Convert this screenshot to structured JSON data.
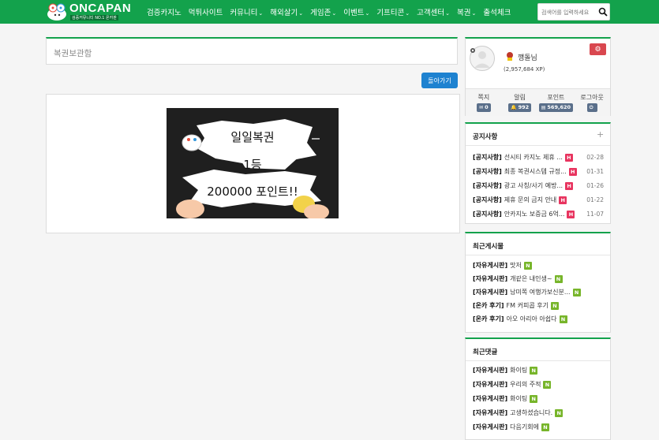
{
  "header": {
    "logo_text": "ONCAPAN",
    "logo_sub": "검증커뮤니티 NO.1 온카판",
    "nav": [
      {
        "label": "검증카지노",
        "dropdown": false
      },
      {
        "label": "먹튀사이트",
        "dropdown": false
      },
      {
        "label": "커뮤니티",
        "dropdown": true
      },
      {
        "label": "해외살기",
        "dropdown": true
      },
      {
        "label": "게임존",
        "dropdown": true
      },
      {
        "label": "이벤트",
        "dropdown": true
      },
      {
        "label": "기프티콘",
        "dropdown": true
      },
      {
        "label": "고객센터",
        "dropdown": true
      },
      {
        "label": "복권",
        "dropdown": true
      },
      {
        "label": "출석체크",
        "dropdown": false
      }
    ],
    "caret": "⌄",
    "search_placeholder": "검색어를 입력하세요"
  },
  "main": {
    "page_title": "복권보관함",
    "back_label": "돌아가기",
    "ticket": {
      "line1": "일일복권",
      "line2": "1등",
      "line3": "200000 포인트!!"
    }
  },
  "profile": {
    "nickname": "깽돌님",
    "xp": "(2,957,684 XP)",
    "stats": [
      {
        "label": "쪽지",
        "value": "0",
        "icon": "mail-icon"
      },
      {
        "label": "알림",
        "value": "992",
        "icon": "bell-icon"
      },
      {
        "label": "포인트",
        "value": "569,620",
        "icon": "point-icon"
      },
      {
        "label": "로그아웃",
        "value": "",
        "icon": "power-icon"
      }
    ]
  },
  "notice": {
    "title": "공지사항",
    "plus": "+",
    "items": [
      {
        "category": "[공지사항]",
        "text": "선시티 카지노 제휴 ...",
        "badge": "H",
        "date": "02-28"
      },
      {
        "category": "[공지사항]",
        "text": "최종 복권시스템 규정...",
        "badge": "H",
        "date": "01-31"
      },
      {
        "category": "[공지사항]",
        "text": "광고 사칭/사기 예방...",
        "badge": "H",
        "date": "01-26"
      },
      {
        "category": "[공지사항]",
        "text": "제휴 문의 금지 안내",
        "badge": "H",
        "date": "01-22"
      },
      {
        "category": "[공지사항]",
        "text": "안카지노 보증금 6억...",
        "badge": "H",
        "date": "11-07"
      }
    ]
  },
  "recent_posts": {
    "title": "최근게시물",
    "items": [
      {
        "category": "[자유게시판]",
        "text": "맛저",
        "badge": "N"
      },
      {
        "category": "[자유게시판]",
        "text": "개같은 내인생~",
        "badge": "N"
      },
      {
        "category": "[자유게시판]",
        "text": "남미쪽 여행가보신분...",
        "badge": "N"
      },
      {
        "category": "[온카 후기]",
        "text": "FM 커피콥 후기",
        "badge": "N"
      },
      {
        "category": "[온카 후기]",
        "text": "아오 아리아 아쉽다",
        "badge": "N"
      }
    ]
  },
  "recent_comments": {
    "title": "최근댓글",
    "items": [
      {
        "category": "[자유게시판]",
        "text": "화이팅",
        "badge": "N"
      },
      {
        "category": "[자유게시판]",
        "text": "우리의 주적",
        "badge": "N"
      },
      {
        "category": "[자유게시판]",
        "text": "화이팅",
        "badge": "N"
      },
      {
        "category": "[자유게시판]",
        "text": "고생하셨습니다.",
        "badge": "N"
      },
      {
        "category": "[자유게시판]",
        "text": "다음기회에",
        "badge": "N"
      }
    ]
  },
  "colors": {
    "brand_green": "#13a24c",
    "button_blue": "#1e82d0",
    "hot_badge": "#e8345f",
    "new_badge": "#77b52a"
  }
}
